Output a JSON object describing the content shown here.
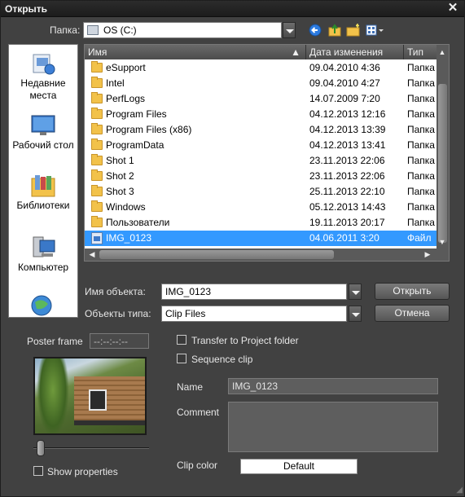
{
  "window": {
    "title": "Открыть"
  },
  "lookin": {
    "label": "Папка:",
    "value": "OS (C:)"
  },
  "toolbar": {
    "icons": [
      "back-icon",
      "up-folder-icon",
      "new-folder-icon",
      "view-menu-icon"
    ]
  },
  "places": [
    {
      "label": "Недавние места",
      "icon": "recent-places-icon"
    },
    {
      "label": "Рабочий стол",
      "icon": "desktop-icon"
    },
    {
      "label": "Библиотеки",
      "icon": "libraries-icon"
    },
    {
      "label": "Компьютер",
      "icon": "computer-icon"
    },
    {
      "label": "",
      "icon": "network-icon"
    }
  ],
  "filelist": {
    "columns": [
      "Имя",
      "Дата изменения",
      "Тип"
    ],
    "rows": [
      {
        "name": "eSupport",
        "date": "09.04.2010 4:36",
        "type": "Папка"
      },
      {
        "name": "Intel",
        "date": "09.04.2010 4:27",
        "type": "Папка"
      },
      {
        "name": "PerfLogs",
        "date": "14.07.2009 7:20",
        "type": "Папка"
      },
      {
        "name": "Program Files",
        "date": "04.12.2013 12:16",
        "type": "Папка"
      },
      {
        "name": "Program Files (x86)",
        "date": "04.12.2013 13:39",
        "type": "Папка"
      },
      {
        "name": "ProgramData",
        "date": "04.12.2013 13:41",
        "type": "Папка"
      },
      {
        "name": "Shot 1",
        "date": "23.11.2013 22:06",
        "type": "Папка"
      },
      {
        "name": "Shot 2",
        "date": "23.11.2013 22:06",
        "type": "Папка"
      },
      {
        "name": "Shot 3",
        "date": "25.11.2013 22:10",
        "type": "Папка"
      },
      {
        "name": "Windows",
        "date": "05.12.2013 14:43",
        "type": "Папка"
      },
      {
        "name": "Пользователи",
        "date": "19.11.2013 20:17",
        "type": "Папка"
      },
      {
        "name": "IMG_0123",
        "date": "04.06.2011 3:20",
        "type": "Файл",
        "selected": true
      }
    ]
  },
  "filename": {
    "label": "Имя объекта:",
    "value": "IMG_0123"
  },
  "filetype": {
    "label": "Объекты типа:",
    "value": "Clip Files"
  },
  "buttons": {
    "open": "Открыть",
    "cancel": "Отмена"
  },
  "preview": {
    "poster_label": "Poster frame",
    "poster_time": "--:--:--:--",
    "show_properties": "Show properties"
  },
  "options": {
    "transfer": "Transfer to Project folder",
    "sequence": "Sequence clip",
    "name_label": "Name",
    "name_value": "IMG_0123",
    "comment_label": "Comment",
    "clipcolor_label": "Clip color",
    "clipcolor_value": "Default"
  },
  "colors": {
    "selection": "#3399ff",
    "panel": "#414141",
    "folder": "#f2c24a"
  }
}
